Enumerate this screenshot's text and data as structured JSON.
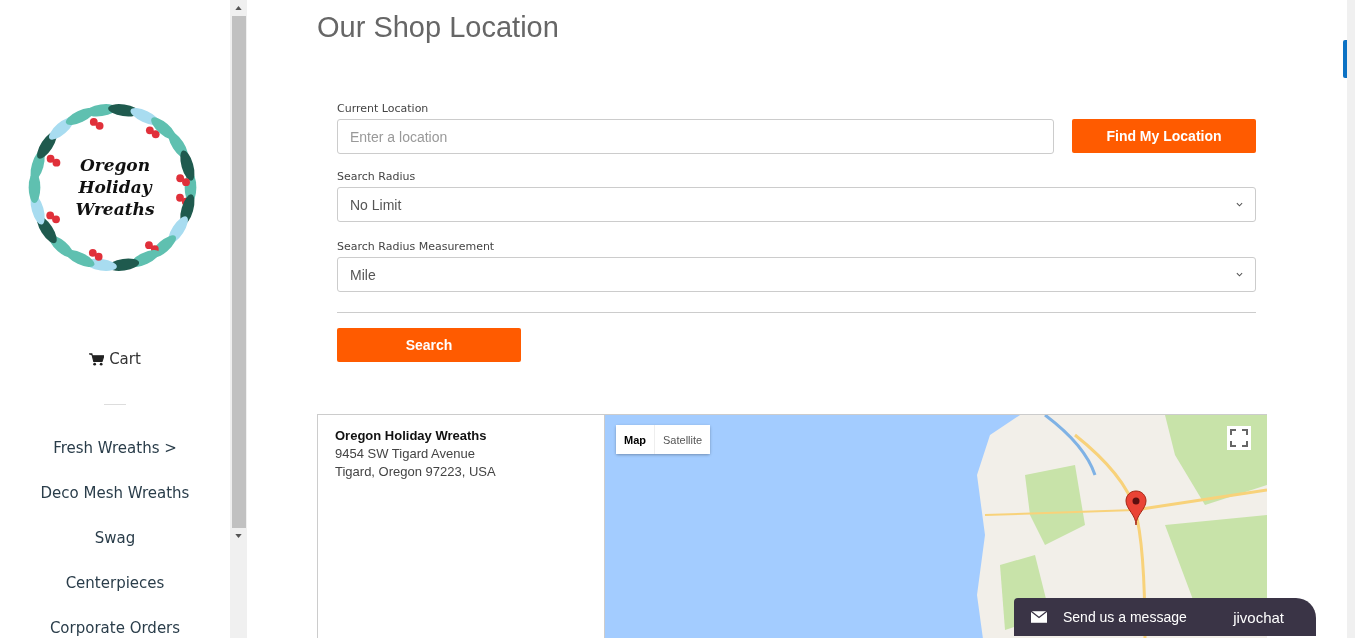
{
  "logo": {
    "lines": [
      "Oregon",
      "Holiday",
      "Wreaths"
    ]
  },
  "sidebar": {
    "cart": "Cart",
    "items": [
      {
        "label": "Fresh Wreaths >"
      },
      {
        "label": "Deco Mesh Wreaths"
      },
      {
        "label": "Swag"
      },
      {
        "label": "Centerpieces"
      },
      {
        "label": "Corporate Orders"
      }
    ]
  },
  "page_title": "Our Shop Location",
  "form": {
    "location": {
      "label": "Current Location",
      "placeholder": "Enter a location"
    },
    "find_button": "Find My Location",
    "radius": {
      "label": "Search Radius",
      "value": "No Limit"
    },
    "measurement": {
      "label": "Search Radius Measurement",
      "value": "Mile"
    },
    "search_button": "Search"
  },
  "results": [
    {
      "name": "Oregon Holiday Wreaths",
      "address": [
        "9454 SW Tigard Avenue",
        "Tigard, Oregon 97223, USA"
      ]
    }
  ],
  "map": {
    "types": [
      {
        "label": "Map",
        "selected": true
      },
      {
        "label": "Satellite",
        "selected": false
      }
    ]
  },
  "chat": {
    "message": "Send us a message",
    "brand": "jivochat"
  }
}
